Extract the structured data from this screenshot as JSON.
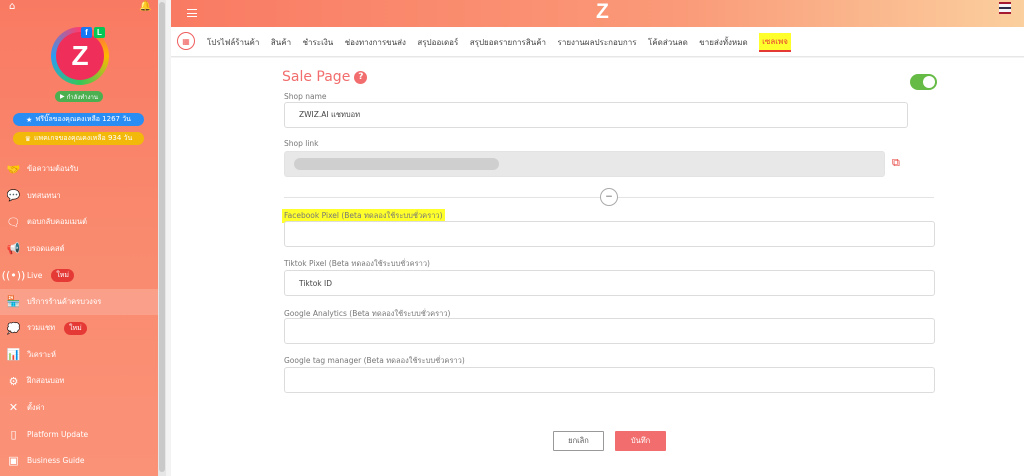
{
  "sidebar": {
    "status": "กำลังทำงาน",
    "free_trial": "ฟรีบิ๊ลของคุณคงเหลือ 1267 วัน",
    "package": "แพคเกจของคุณคงเหลือ 934 วัน",
    "items": [
      {
        "label": "ข้อความต้อนรับ"
      },
      {
        "label": "บทสนทนา"
      },
      {
        "label": "ตอบกลับคอมเมนต์"
      },
      {
        "label": "บรอดแคสต์"
      },
      {
        "label": "Live",
        "badge": "ใหม่"
      },
      {
        "label": "บริการร้านค้าครบวงจร"
      },
      {
        "label": "รวมแชท",
        "badge": "ใหม่"
      },
      {
        "label": "วิเคราะห์"
      },
      {
        "label": "ฝึกสอนบอท"
      },
      {
        "label": "ตั้งค่า"
      },
      {
        "label": "Platform Update"
      },
      {
        "label": "Business Guide"
      }
    ]
  },
  "topbar": {
    "logo": "Z"
  },
  "tabs": [
    "โปรไฟล์ร้านค้า",
    "สินค้า",
    "ชำระเงิน",
    "ช่องทางการขนส่ง",
    "สรุปออเดอร์",
    "สรุปยอดรายการสินค้า",
    "รายงานผลประกอบการ",
    "โค้ดส่วนลด",
    "ขายส่งทั้งหมด",
    "เซลเพจ"
  ],
  "page": {
    "title": "Sale Page",
    "shop_name_label": "Shop name",
    "shop_name_value": "ZWIZ.AI แชทบอท",
    "shop_link_label": "Shop link",
    "facebook_pixel_label": "Facebook Pixel (Beta ทดลองใช้ระบบชั่วคราว)",
    "facebook_pixel_value": "",
    "tiktok_pixel_label": "Tiktok Pixel (Beta ทดลองใช้ระบบชั่วคราว)",
    "tiktok_pixel_value": "Tiktok ID",
    "google_analytics_label": "Google Analytics (Beta ทดลองใช้ระบบชั่วคราว)",
    "google_analytics_value": "",
    "google_tag_manager_label": "Google tag manager (Beta ทดลองใช้ระบบชั่วคราว)",
    "google_tag_manager_value": "",
    "cancel": "ยกเลิก",
    "save": "บันทึก"
  }
}
